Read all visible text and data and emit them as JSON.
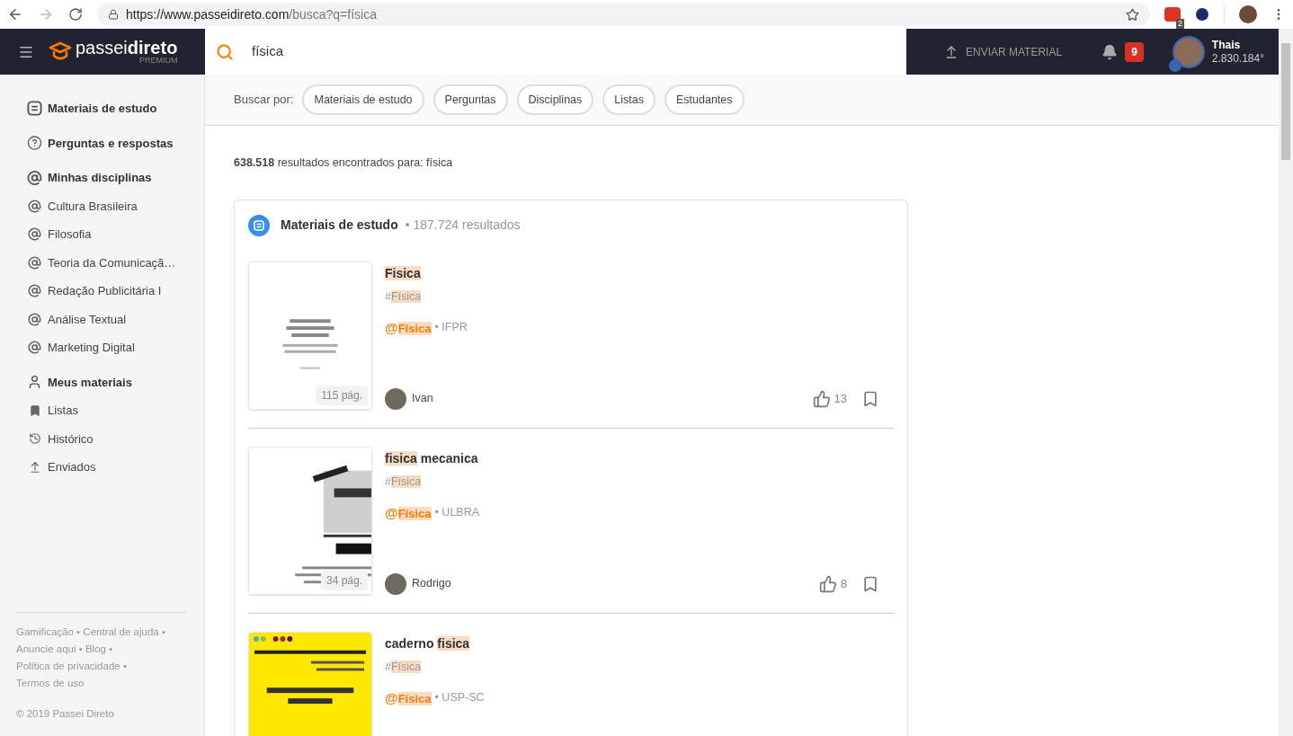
{
  "browser": {
    "url_host": "https://www.passeidireto.com",
    "url_path": "/busca?q=física",
    "extension_badge": "2"
  },
  "header": {
    "logo_light": "passei",
    "logo_bold": "direto",
    "logo_sub": "PREMIUM",
    "search_value": "física",
    "upload": "ENVIAR MATERIAL",
    "notifications": "9",
    "user": {
      "name": "Thais",
      "points": "2.830.184°"
    }
  },
  "filters": {
    "label": "Buscar por:",
    "chips": [
      "Materiais de estudo",
      "Perguntas",
      "Disciplinas",
      "Listas",
      "Estudantes"
    ]
  },
  "sidebar": [
    {
      "title": "Materiais de estudo"
    },
    {
      "title": "Perguntas e respostas"
    },
    {
      "title": "Minhas disciplinas",
      "items": [
        "Cultura Brasileira",
        "Filosofia",
        "Teoria da Comunicaçã…",
        "Redação Publicitária I",
        "Análise Textual",
        "Marketing Digital"
      ]
    },
    {
      "title": "Meus materiais",
      "items": [
        "Listas",
        "Histórico",
        "Enviados"
      ]
    }
  ],
  "footer": {
    "separator": "•",
    "links": [
      "Gamificação",
      "Central de ajuda",
      "Anuncie aqui",
      "Blog",
      "Política de privacidade",
      "Termos de uso"
    ],
    "copyright": "© 2019 Passei Direto"
  },
  "summary": "**638.518** resultados encontrados para: física",
  "section": {
    "title": "Materiais de estudo",
    "count": "• 187.724 resultados",
    "items": [
      {
        "title": [
          {
            "text": "Fisica",
            "highlight": true
          }
        ],
        "tag_mark": "#",
        "tag": "Física",
        "discipline_mark": "@",
        "discipline": "Física",
        "institution": "• IFPR",
        "author": "Ivan",
        "likes": "13",
        "pages": "115 pág."
      },
      {
        "title": [
          {
            "text": "fisica",
            "highlight": true
          },
          {
            "text": " mecanica",
            "highlight": false
          }
        ],
        "tag_mark": "#",
        "tag": "Física",
        "discipline_mark": "@",
        "discipline": "Física",
        "institution": "• ULBRA",
        "author": "Rodrigo",
        "likes": "8",
        "pages": "34 pág."
      },
      {
        "title": [
          {
            "text": "caderno ",
            "highlight": false
          },
          {
            "text": "fisica",
            "highlight": true
          }
        ],
        "tag_mark": "#",
        "tag": "Física",
        "discipline_mark": "@",
        "discipline": "Física",
        "institution": "• USP-SC"
      }
    ]
  }
}
